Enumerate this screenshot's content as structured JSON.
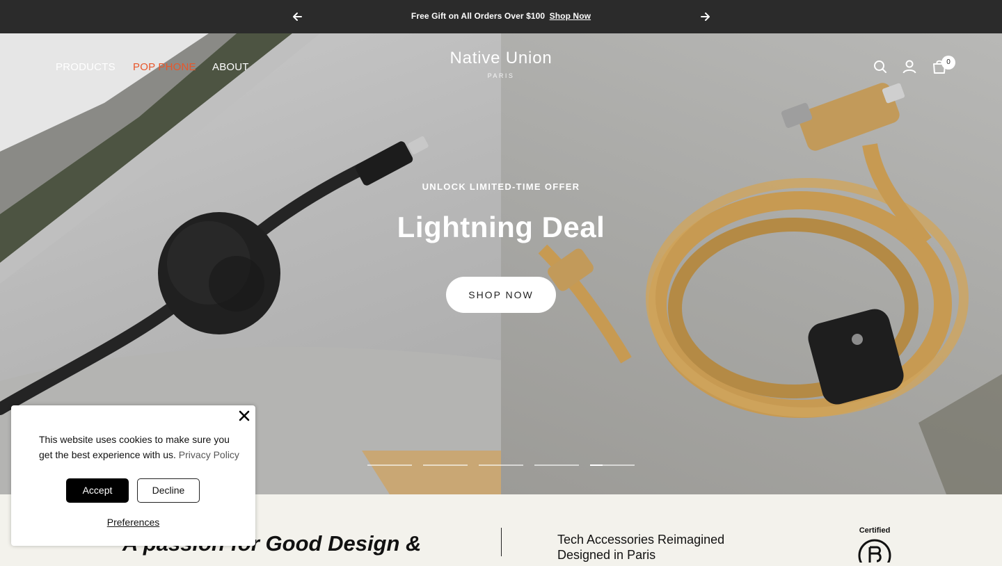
{
  "announcement": {
    "message": "Free Gift on All Orders Over $100",
    "link_label": "Shop Now",
    "prev_icon": "arrow-left-icon",
    "next_icon": "arrow-right-icon"
  },
  "header": {
    "nav": [
      {
        "label": "PRODUCTS"
      },
      {
        "label": "POP PHONE",
        "color": "#e8562a"
      },
      {
        "label": "ABOUT"
      }
    ],
    "logo": {
      "name": "Native Union",
      "sub": "PARIS"
    },
    "icons": [
      "search-icon",
      "account-icon",
      "cart-icon"
    ],
    "cart_count": "0"
  },
  "hero": {
    "eyebrow": "UNLOCK LIMITED-TIME OFFER",
    "title": "Lightning Deal",
    "cta_label": "SHOP NOW",
    "slide_count": 5,
    "active_slide": 5
  },
  "intro": {
    "tagline": "A passion for Good Design &",
    "subcopy_line1": "Tech Accessories Reimagined",
    "subcopy_line2": "Designed in Paris",
    "badge_text": "Certified"
  },
  "cookie": {
    "message": "This website uses cookies to make sure you get the best experience with us.",
    "policy_link": "Privacy Policy",
    "accept_label": "Accept",
    "decline_label": "Decline",
    "preferences_label": "Preferences"
  }
}
